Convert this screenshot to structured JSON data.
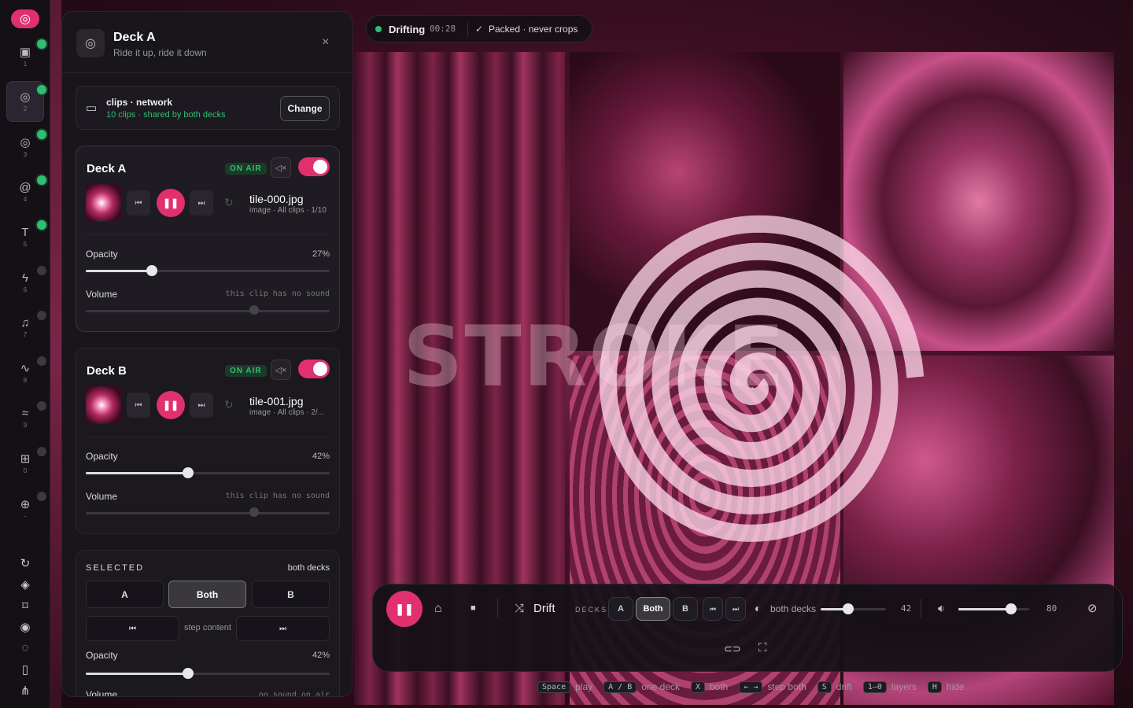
{
  "overlay_text": "STROKE",
  "rail": {
    "items": [
      {
        "icon": "image-icon",
        "num": "1"
      },
      {
        "icon": "target-icon",
        "num": "2"
      },
      {
        "icon": "target-icon",
        "num": "3"
      },
      {
        "icon": "spiral-icon",
        "num": "4"
      },
      {
        "icon": "text-icon",
        "num": "5"
      },
      {
        "icon": "bolt-icon",
        "num": "6"
      },
      {
        "icon": "music-icon",
        "num": "7"
      },
      {
        "icon": "pulse-icon",
        "num": "8"
      },
      {
        "icon": "wave-icon",
        "num": "9"
      },
      {
        "icon": "grid-icon",
        "num": "0"
      },
      {
        "icon": "crosshair-icon",
        "num": "-"
      }
    ],
    "active_index": 1,
    "status_dots": [
      "on",
      "on",
      "on",
      "on",
      "on",
      "off",
      "off",
      "off",
      "off",
      "off",
      "off"
    ],
    "bottom_icons": [
      "refresh-icon",
      "layers-icon",
      "bookmark-icon",
      "record-icon",
      "eye-icon",
      "vibrate-icon",
      "share-icon"
    ]
  },
  "panel": {
    "title": "Deck A",
    "subtitle": "Ride it up, ride it down",
    "close": "×",
    "folder": {
      "name": "clips · network",
      "sub": "10 clips · shared by both decks",
      "change_label": "Change"
    },
    "decks": [
      {
        "name": "Deck A",
        "badge": "ON AIR",
        "clip": "tile-000.jpg",
        "meta": "image · All clips · 1/10",
        "opacity_label": "Opacity",
        "opacity_value": "27%",
        "opacity": 0.27,
        "volume_label": "Volume",
        "volume_note": "this clip has no sound",
        "volume": 0.69
      },
      {
        "name": "Deck B",
        "badge": "ON AIR",
        "clip": "tile-001.jpg",
        "meta": "image · All clips · 2/...",
        "opacity_label": "Opacity",
        "opacity_value": "42%",
        "opacity": 0.42,
        "volume_label": "Volume",
        "volume_note": "this clip has no sound",
        "volume": 0.69
      }
    ],
    "selected": {
      "title": "SELECTED",
      "scope": "both decks",
      "segments": [
        "A",
        "Both",
        "B"
      ],
      "active_segment": "Both",
      "step_label": "step content",
      "opacity_label": "Opacity",
      "opacity_value": "42%",
      "opacity": 0.42,
      "volume_label": "Volume",
      "volume_note": "no sound on air"
    }
  },
  "topbar": {
    "status": "Drifting",
    "time": "00:28",
    "mode": "Packed · never crops"
  },
  "controls": {
    "drift_label": "Drift",
    "decks_label": "DECKS",
    "deck_buttons": [
      "A",
      "Both",
      "B"
    ],
    "active_deck": "Both",
    "opacity_scope": "both decks",
    "opacity_value": "42",
    "opacity": 0.42,
    "volume_value": "80",
    "volume": 0.8
  },
  "shortcuts": [
    {
      "key": "Space",
      "desc": "play"
    },
    {
      "key": "A / B",
      "desc": "one deck"
    },
    {
      "key": "X",
      "desc": "both"
    },
    {
      "key": "← →",
      "desc": "step both"
    },
    {
      "key": "S",
      "desc": "drift"
    },
    {
      "key": "1–0",
      "desc": "layers"
    },
    {
      "key": "H",
      "desc": "hide"
    }
  ],
  "colors": {
    "accent": "#e0306e",
    "live": "#2fbf71",
    "panel": "#18151b"
  }
}
